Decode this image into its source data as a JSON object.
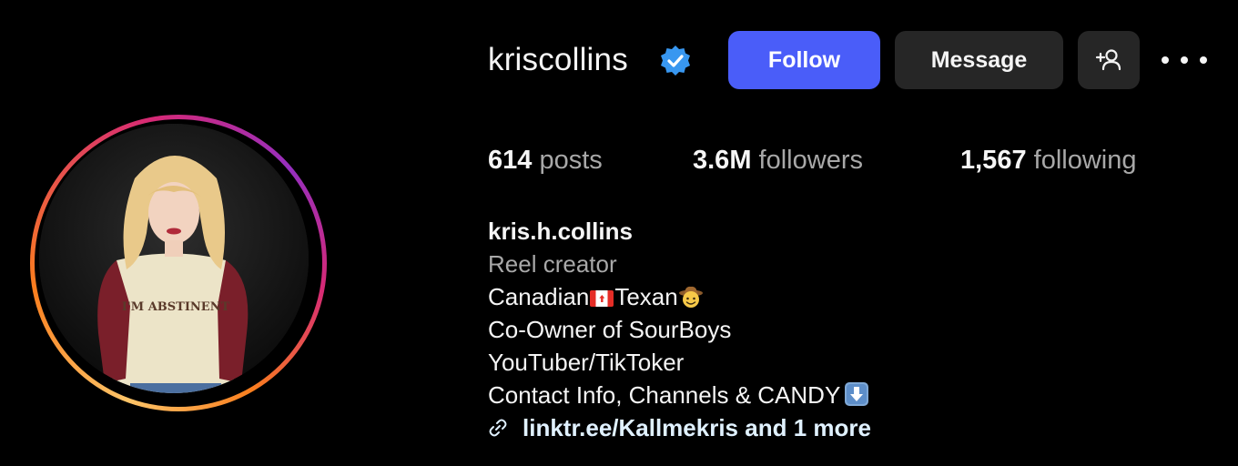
{
  "profile": {
    "username": "kriscollins",
    "verified": true,
    "verified_color": "#3897f0"
  },
  "actions": {
    "follow_label": "Follow",
    "message_label": "Message",
    "add_user_icon": "person-plus-icon",
    "more_icon": "more-horizontal-icon",
    "follow_color": "#4a5df9"
  },
  "stats": {
    "posts": {
      "count": "614",
      "label": "posts"
    },
    "followers": {
      "count": "3.6M",
      "label": "followers"
    },
    "following": {
      "count": "1,567",
      "label": "following"
    }
  },
  "bio": {
    "name": "kris.h.collins",
    "category": "Reel creator",
    "line1_a": "Canadian",
    "line1_b": "Texan",
    "line2": "Co-Owner of SourBoys",
    "line3": "YouTuber/TikToker",
    "line4": "Contact Info, Channels & CANDY",
    "link": "linktr.ee/Kallmekris and 1 more"
  }
}
